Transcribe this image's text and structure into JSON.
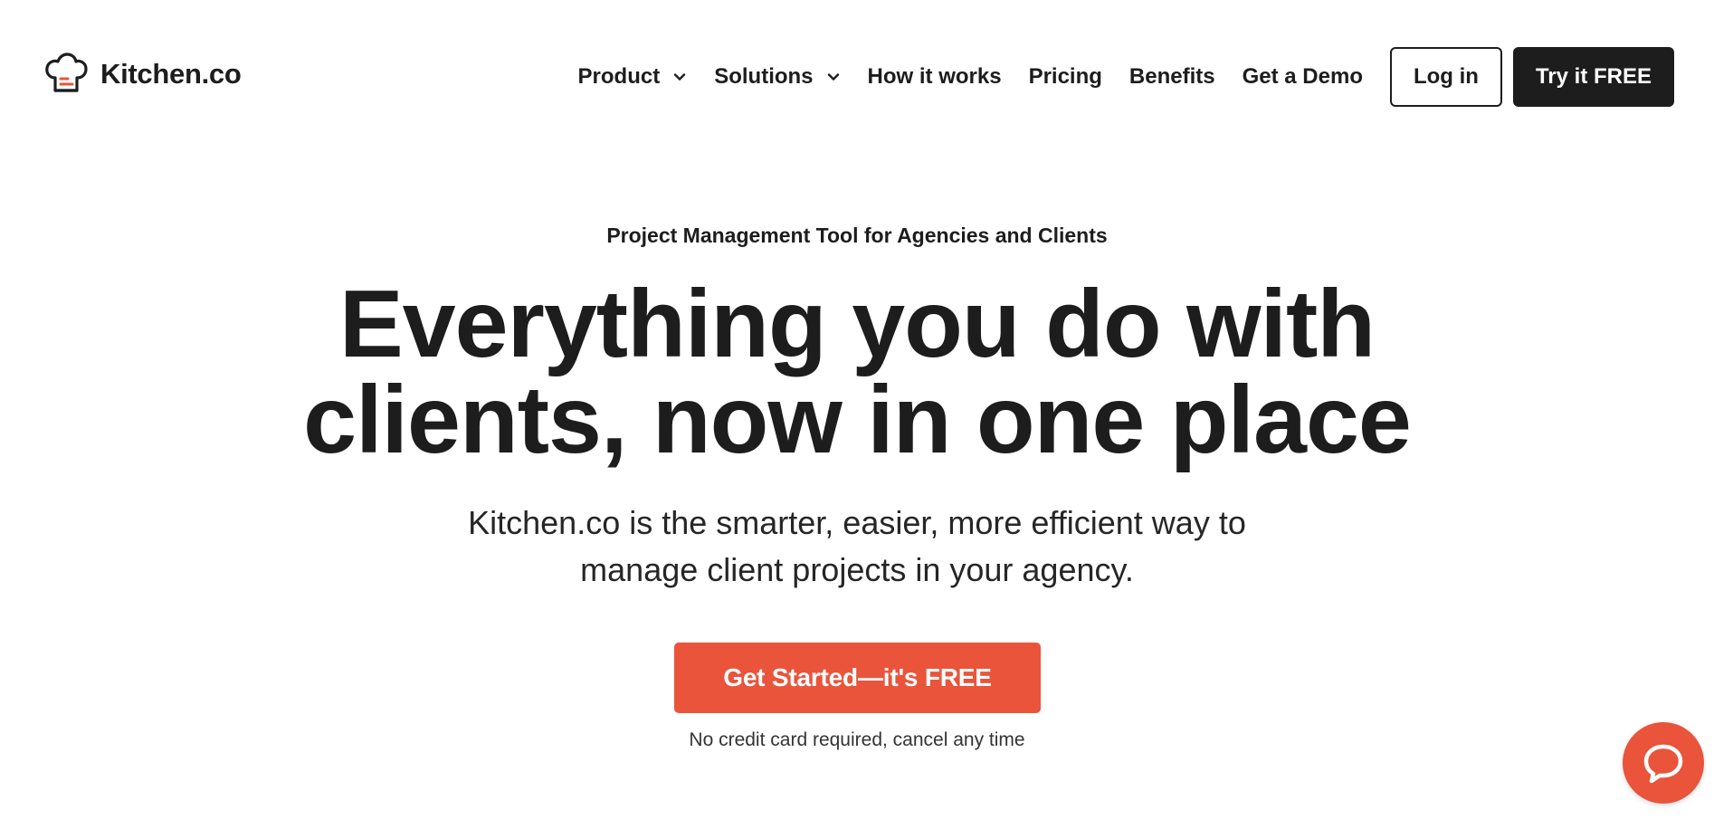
{
  "brand": {
    "name": "Kitchen.co"
  },
  "nav": {
    "items": [
      {
        "label": "Product",
        "has_dropdown": true
      },
      {
        "label": "Solutions",
        "has_dropdown": true
      },
      {
        "label": "How it works"
      },
      {
        "label": "Pricing"
      },
      {
        "label": "Benefits"
      },
      {
        "label": "Get a Demo"
      }
    ],
    "login_label": "Log in",
    "try_label": "Try it FREE"
  },
  "hero": {
    "eyebrow": "Project Management Tool for Agencies and Clients",
    "headline_line1": "Everything you do with",
    "headline_line2": "clients, now in one place",
    "subtitle_line1": "Kitchen.co is the smarter, easier, more efficient way to",
    "subtitle_line2": "manage client projects in your agency.",
    "cta_label": "Get Started—it's FREE",
    "cta_note": "No credit card required, cancel any time"
  },
  "icons": {
    "logo": "chef-hat-icon",
    "dropdown": "chevron-down-icon",
    "chat": "chat-bubble-icon"
  },
  "colors": {
    "accent": "#e9543b",
    "text": "#1d1d1d",
    "background": "#ffffff"
  }
}
